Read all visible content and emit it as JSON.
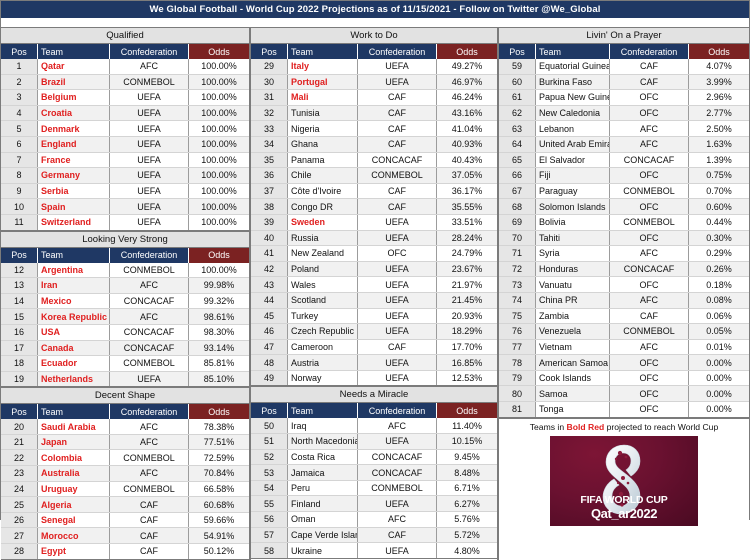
{
  "title": "We Global Football - World Cup 2022 Projections as of 11/15/2021 - Follow on Twitter @We_Global",
  "colors": {
    "title_bar": "#1f3864",
    "header_blue": "#1f3864",
    "odds_header": "#7b2222",
    "band_gray": "#e2e2e2",
    "highlight_red": "#e02020"
  },
  "columns": {
    "pos": "Pos",
    "team": "Team",
    "confederation": "Confederation",
    "odds": "Odds"
  },
  "footer": {
    "note_pre": "Teams in ",
    "note_bold": "Bold Red",
    "note_post": " projected to reach World Cup",
    "logo_line1": "FIFA WORLD CUP",
    "logo_line2": "Qat_ar2022",
    "logo_alt": "fifa-world-cup-qatar-2022-logo"
  },
  "sections": [
    {
      "id": "qualified",
      "caption": "Qualified",
      "column": "left",
      "rows": [
        {
          "pos": 1,
          "team": "Qatar",
          "conf": "AFC",
          "odds": "100.00%",
          "bold_red": true
        },
        {
          "pos": 2,
          "team": "Brazil",
          "conf": "CONMEBOL",
          "odds": "100.00%",
          "bold_red": true
        },
        {
          "pos": 3,
          "team": "Belgium",
          "conf": "UEFA",
          "odds": "100.00%",
          "bold_red": true
        },
        {
          "pos": 4,
          "team": "Croatia",
          "conf": "UEFA",
          "odds": "100.00%",
          "bold_red": true
        },
        {
          "pos": 5,
          "team": "Denmark",
          "conf": "UEFA",
          "odds": "100.00%",
          "bold_red": true
        },
        {
          "pos": 6,
          "team": "England",
          "conf": "UEFA",
          "odds": "100.00%",
          "bold_red": true
        },
        {
          "pos": 7,
          "team": "France",
          "conf": "UEFA",
          "odds": "100.00%",
          "bold_red": true
        },
        {
          "pos": 8,
          "team": "Germany",
          "conf": "UEFA",
          "odds": "100.00%",
          "bold_red": true
        },
        {
          "pos": 9,
          "team": "Serbia",
          "conf": "UEFA",
          "odds": "100.00%",
          "bold_red": true
        },
        {
          "pos": 10,
          "team": "Spain",
          "conf": "UEFA",
          "odds": "100.00%",
          "bold_red": true
        },
        {
          "pos": 11,
          "team": "Switzerland",
          "conf": "UEFA",
          "odds": "100.00%",
          "bold_red": true
        }
      ]
    },
    {
      "id": "looking-very-strong",
      "caption": "Looking Very Strong",
      "column": "left",
      "rows": [
        {
          "pos": 12,
          "team": "Argentina",
          "conf": "CONMEBOL",
          "odds": "100.00%",
          "bold_red": true
        },
        {
          "pos": 13,
          "team": "Iran",
          "conf": "AFC",
          "odds": "99.98%",
          "bold_red": true
        },
        {
          "pos": 14,
          "team": "Mexico",
          "conf": "CONCACAF",
          "odds": "99.32%",
          "bold_red": true
        },
        {
          "pos": 15,
          "team": "Korea Republic",
          "conf": "AFC",
          "odds": "98.61%",
          "bold_red": true
        },
        {
          "pos": 16,
          "team": "USA",
          "conf": "CONCACAF",
          "odds": "98.30%",
          "bold_red": true
        },
        {
          "pos": 17,
          "team": "Canada",
          "conf": "CONCACAF",
          "odds": "93.14%",
          "bold_red": true
        },
        {
          "pos": 18,
          "team": "Ecuador",
          "conf": "CONMEBOL",
          "odds": "85.81%",
          "bold_red": true
        },
        {
          "pos": 19,
          "team": "Netherlands",
          "conf": "UEFA",
          "odds": "85.10%",
          "bold_red": true
        }
      ]
    },
    {
      "id": "decent-shape",
      "caption": "Decent Shape",
      "column": "left",
      "rows": [
        {
          "pos": 20,
          "team": "Saudi Arabia",
          "conf": "AFC",
          "odds": "78.38%",
          "bold_red": true
        },
        {
          "pos": 21,
          "team": "Japan",
          "conf": "AFC",
          "odds": "77.51%",
          "bold_red": true
        },
        {
          "pos": 22,
          "team": "Colombia",
          "conf": "CONMEBOL",
          "odds": "72.59%",
          "bold_red": true
        },
        {
          "pos": 23,
          "team": "Australia",
          "conf": "AFC",
          "odds": "70.84%",
          "bold_red": true
        },
        {
          "pos": 24,
          "team": "Uruguay",
          "conf": "CONMEBOL",
          "odds": "66.58%",
          "bold_red": true
        },
        {
          "pos": 25,
          "team": "Algeria",
          "conf": "CAF",
          "odds": "60.68%",
          "bold_red": true
        },
        {
          "pos": 26,
          "team": "Senegal",
          "conf": "CAF",
          "odds": "59.66%",
          "bold_red": true
        },
        {
          "pos": 27,
          "team": "Morocco",
          "conf": "CAF",
          "odds": "54.91%",
          "bold_red": true
        },
        {
          "pos": 28,
          "team": "Egypt",
          "conf": "CAF",
          "odds": "50.12%",
          "bold_red": true
        }
      ]
    },
    {
      "id": "work-to-do",
      "caption": "Work to Do",
      "column": "mid",
      "rows": [
        {
          "pos": 29,
          "team": "Italy",
          "conf": "UEFA",
          "odds": "49.27%",
          "bold_red": true
        },
        {
          "pos": 30,
          "team": "Portugal",
          "conf": "UEFA",
          "odds": "46.97%",
          "bold_red": true
        },
        {
          "pos": 31,
          "team": "Mali",
          "conf": "CAF",
          "odds": "46.24%",
          "bold_red": true
        },
        {
          "pos": 32,
          "team": "Tunisia",
          "conf": "CAF",
          "odds": "43.16%",
          "bold_red": false
        },
        {
          "pos": 33,
          "team": "Nigeria",
          "conf": "CAF",
          "odds": "41.04%",
          "bold_red": false
        },
        {
          "pos": 34,
          "team": "Ghana",
          "conf": "CAF",
          "odds": "40.93%",
          "bold_red": false
        },
        {
          "pos": 35,
          "team": "Panama",
          "conf": "CONCACAF",
          "odds": "40.43%",
          "bold_red": false
        },
        {
          "pos": 36,
          "team": "Chile",
          "conf": "CONMEBOL",
          "odds": "37.05%",
          "bold_red": false
        },
        {
          "pos": 37,
          "team": "Côte d'Ivoire",
          "conf": "CAF",
          "odds": "36.17%",
          "bold_red": false
        },
        {
          "pos": 38,
          "team": "Congo DR",
          "conf": "CAF",
          "odds": "35.55%",
          "bold_red": false
        },
        {
          "pos": 39,
          "team": "Sweden",
          "conf": "UEFA",
          "odds": "33.51%",
          "bold_red": true
        },
        {
          "pos": 40,
          "team": "Russia",
          "conf": "UEFA",
          "odds": "28.24%",
          "bold_red": false
        },
        {
          "pos": 41,
          "team": "New Zealand",
          "conf": "OFC",
          "odds": "24.79%",
          "bold_red": false
        },
        {
          "pos": 42,
          "team": "Poland",
          "conf": "UEFA",
          "odds": "23.67%",
          "bold_red": false
        },
        {
          "pos": 43,
          "team": "Wales",
          "conf": "UEFA",
          "odds": "21.97%",
          "bold_red": false
        },
        {
          "pos": 44,
          "team": "Scotland",
          "conf": "UEFA",
          "odds": "21.45%",
          "bold_red": false
        },
        {
          "pos": 45,
          "team": "Turkey",
          "conf": "UEFA",
          "odds": "20.93%",
          "bold_red": false
        },
        {
          "pos": 46,
          "team": "Czech Republic",
          "conf": "UEFA",
          "odds": "18.29%",
          "bold_red": false
        },
        {
          "pos": 47,
          "team": "Cameroon",
          "conf": "CAF",
          "odds": "17.70%",
          "bold_red": false
        },
        {
          "pos": 48,
          "team": "Austria",
          "conf": "UEFA",
          "odds": "16.85%",
          "bold_red": false
        },
        {
          "pos": 49,
          "team": "Norway",
          "conf": "UEFA",
          "odds": "12.53%",
          "bold_red": false
        }
      ]
    },
    {
      "id": "needs-a-miracle",
      "caption": "Needs a Miracle",
      "column": "mid",
      "rows": [
        {
          "pos": 50,
          "team": "Iraq",
          "conf": "AFC",
          "odds": "11.40%",
          "bold_red": false
        },
        {
          "pos": 51,
          "team": "North Macedonia",
          "conf": "UEFA",
          "odds": "10.15%",
          "bold_red": false
        },
        {
          "pos": 52,
          "team": "Costa Rica",
          "conf": "CONCACAF",
          "odds": "9.45%",
          "bold_red": false
        },
        {
          "pos": 53,
          "team": "Jamaica",
          "conf": "CONCACAF",
          "odds": "8.48%",
          "bold_red": false
        },
        {
          "pos": 54,
          "team": "Peru",
          "conf": "CONMEBOL",
          "odds": "6.71%",
          "bold_red": false
        },
        {
          "pos": 55,
          "team": "Finland",
          "conf": "UEFA",
          "odds": "6.27%",
          "bold_red": false
        },
        {
          "pos": 56,
          "team": "Oman",
          "conf": "AFC",
          "odds": "5.76%",
          "bold_red": false
        },
        {
          "pos": 57,
          "team": "Cape Verde Islands",
          "conf": "CAF",
          "odds": "5.72%",
          "bold_red": false
        },
        {
          "pos": 58,
          "team": "Ukraine",
          "conf": "UEFA",
          "odds": "4.80%",
          "bold_red": false
        }
      ]
    },
    {
      "id": "livin-on-a-prayer",
      "caption": "Livin' On a Prayer",
      "column": "right",
      "rows": [
        {
          "pos": 59,
          "team": "Equatorial Guinea",
          "conf": "CAF",
          "odds": "4.07%",
          "bold_red": false
        },
        {
          "pos": 60,
          "team": "Burkina Faso",
          "conf": "CAF",
          "odds": "3.99%",
          "bold_red": false
        },
        {
          "pos": 61,
          "team": "Papua New Guinea",
          "conf": "OFC",
          "odds": "2.96%",
          "bold_red": false
        },
        {
          "pos": 62,
          "team": "New Caledonia",
          "conf": "OFC",
          "odds": "2.77%",
          "bold_red": false
        },
        {
          "pos": 63,
          "team": "Lebanon",
          "conf": "AFC",
          "odds": "2.50%",
          "bold_red": false
        },
        {
          "pos": 64,
          "team": "United Arab Emirates",
          "conf": "AFC",
          "odds": "1.63%",
          "bold_red": false
        },
        {
          "pos": 65,
          "team": "El Salvador",
          "conf": "CONCACAF",
          "odds": "1.39%",
          "bold_red": false
        },
        {
          "pos": 66,
          "team": "Fiji",
          "conf": "OFC",
          "odds": "0.75%",
          "bold_red": false
        },
        {
          "pos": 67,
          "team": "Paraguay",
          "conf": "CONMEBOL",
          "odds": "0.70%",
          "bold_red": false
        },
        {
          "pos": 68,
          "team": "Solomon Islands",
          "conf": "OFC",
          "odds": "0.60%",
          "bold_red": false
        },
        {
          "pos": 69,
          "team": "Bolivia",
          "conf": "CONMEBOL",
          "odds": "0.44%",
          "bold_red": false
        },
        {
          "pos": 70,
          "team": "Tahiti",
          "conf": "OFC",
          "odds": "0.30%",
          "bold_red": false
        },
        {
          "pos": 71,
          "team": "Syria",
          "conf": "AFC",
          "odds": "0.29%",
          "bold_red": false
        },
        {
          "pos": 72,
          "team": "Honduras",
          "conf": "CONCACAF",
          "odds": "0.26%",
          "bold_red": false
        },
        {
          "pos": 73,
          "team": "Vanuatu",
          "conf": "OFC",
          "odds": "0.18%",
          "bold_red": false
        },
        {
          "pos": 74,
          "team": "China PR",
          "conf": "AFC",
          "odds": "0.08%",
          "bold_red": false
        },
        {
          "pos": 75,
          "team": "Zambia",
          "conf": "CAF",
          "odds": "0.06%",
          "bold_red": false
        },
        {
          "pos": 76,
          "team": "Venezuela",
          "conf": "CONMEBOL",
          "odds": "0.05%",
          "bold_red": false
        },
        {
          "pos": 77,
          "team": "Vietnam",
          "conf": "AFC",
          "odds": "0.01%",
          "bold_red": false
        },
        {
          "pos": 78,
          "team": "American Samoa",
          "conf": "OFC",
          "odds": "0.00%",
          "bold_red": false
        },
        {
          "pos": 79,
          "team": "Cook Islands",
          "conf": "OFC",
          "odds": "0.00%",
          "bold_red": false
        },
        {
          "pos": 80,
          "team": "Samoa",
          "conf": "OFC",
          "odds": "0.00%",
          "bold_red": false
        },
        {
          "pos": 81,
          "team": "Tonga",
          "conf": "OFC",
          "odds": "0.00%",
          "bold_red": false
        }
      ]
    }
  ]
}
